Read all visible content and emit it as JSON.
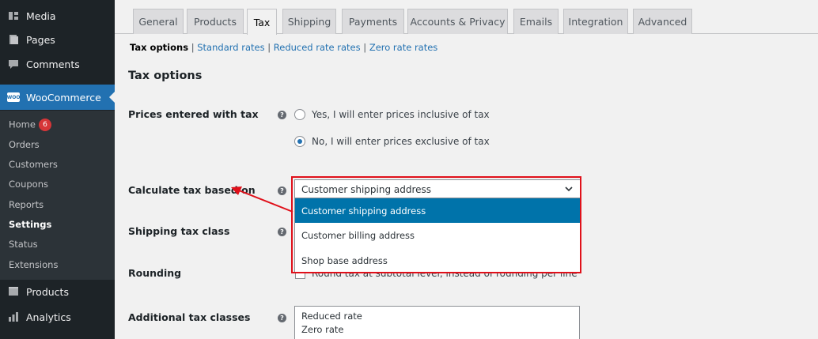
{
  "sidebar": {
    "top_items": [
      {
        "label": "Media",
        "icon": "media-icon"
      },
      {
        "label": "Pages",
        "icon": "pages-icon"
      },
      {
        "label": "Comments",
        "icon": "comments-icon"
      }
    ],
    "active_item": {
      "label": "WooCommerce",
      "icon": "woocommerce-icon",
      "logo_text": "WOO"
    },
    "submenu": [
      {
        "label": "Home",
        "badge": "6"
      },
      {
        "label": "Orders"
      },
      {
        "label": "Customers"
      },
      {
        "label": "Coupons"
      },
      {
        "label": "Reports"
      },
      {
        "label": "Settings",
        "current": true
      },
      {
        "label": "Status"
      },
      {
        "label": "Extensions"
      }
    ],
    "bottom_items": [
      {
        "label": "Products",
        "icon": "products-icon"
      },
      {
        "label": "Analytics",
        "icon": "analytics-icon"
      }
    ]
  },
  "tabs": [
    "General",
    "Products",
    "Tax",
    "Shipping",
    "Payments",
    "Accounts & Privacy",
    "Emails",
    "Integration",
    "Advanced"
  ],
  "active_tab": "Tax",
  "subnav": {
    "current": "Tax options",
    "links": [
      "Standard rates",
      "Reduced rate rates",
      "Zero rate rates"
    ]
  },
  "section_title": "Tax options",
  "fields": {
    "prices_entered": {
      "label": "Prices entered with tax",
      "options": [
        "Yes, I will enter prices inclusive of tax",
        "No, I will enter prices exclusive of tax"
      ],
      "selected_index": 1
    },
    "calculate_tax": {
      "label": "Calculate tax based on",
      "value": "Customer shipping address",
      "options": [
        "Customer shipping address",
        "Customer billing address",
        "Shop base address"
      ],
      "highlighted_index": 0
    },
    "shipping_tax_class": {
      "label": "Shipping tax class"
    },
    "rounding": {
      "label": "Rounding",
      "checkbox_text": "Round tax at subtotal level, instead of rounding per line"
    },
    "additional_tax_classes": {
      "label": "Additional tax classes",
      "lines": [
        "Reduced rate",
        "Zero rate"
      ]
    }
  },
  "colors": {
    "accent": "#2271b1",
    "annotation": "#e0101a",
    "sidebar_bg": "#1d2327"
  }
}
